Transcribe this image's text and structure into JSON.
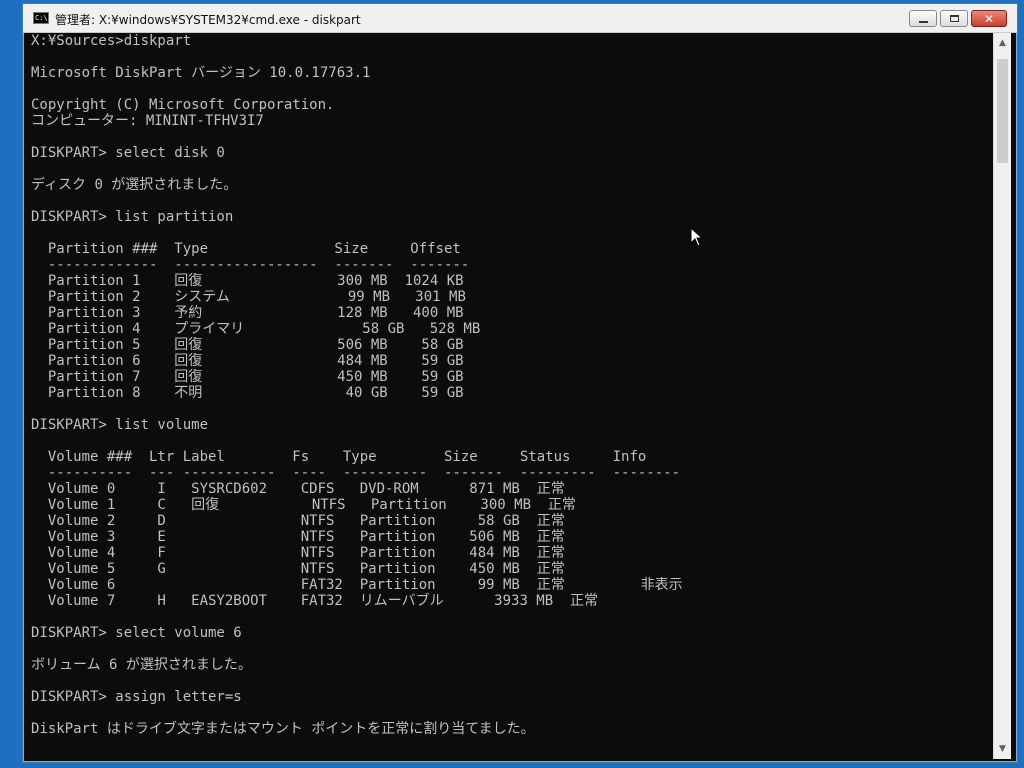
{
  "window": {
    "title": "管理者: X:¥windows¥SYSTEM32¥cmd.exe - diskpart",
    "icon_label": "C:\\."
  },
  "titlebar_buttons": {
    "close_glyph": "✕"
  },
  "console": {
    "lines": [
      "X:¥Sources>diskpart",
      "",
      "Microsoft DiskPart バージョン 10.0.17763.1",
      "",
      "Copyright (C) Microsoft Corporation.",
      "コンピューター: MININT-TFHV3I7",
      "",
      "DISKPART> select disk 0",
      "",
      "ディスク 0 が選択されました。",
      "",
      "DISKPART> list partition",
      "",
      "  Partition ###  Type               Size     Offset",
      "  -------------  -----------------  -------  -------",
      "  Partition 1    回復                300 MB  1024 KB",
      "  Partition 2    システム              99 MB   301 MB",
      "  Partition 3    予約                128 MB   400 MB",
      "  Partition 4    プライマリ              58 GB   528 MB",
      "  Partition 5    回復                506 MB    58 GB",
      "  Partition 6    回復                484 MB    59 GB",
      "  Partition 7    回復                450 MB    59 GB",
      "  Partition 8    不明                 40 GB    59 GB",
      "",
      "DISKPART> list volume",
      "",
      "  Volume ###  Ltr Label        Fs    Type        Size     Status     Info",
      "  ----------  --- -----------  ----  ----------  -------  ---------  --------",
      "  Volume 0     I   SYSRCD602    CDFS   DVD-ROM      871 MB  正常",
      "  Volume 1     C   回復           NTFS   Partition    300 MB  正常",
      "  Volume 2     D                NTFS   Partition     58 GB  正常",
      "  Volume 3     E                NTFS   Partition    506 MB  正常",
      "  Volume 4     F                NTFS   Partition    484 MB  正常",
      "  Volume 5     G                NTFS   Partition    450 MB  正常",
      "  Volume 6                      FAT32  Partition     99 MB  正常         非表示",
      "  Volume 7     H   EASY2BOOT    FAT32  リムーバブル      3933 MB  正常",
      "",
      "DISKPART> select volume 6",
      "",
      "ボリューム 6 が選択されました。",
      "",
      "DISKPART> assign letter=s",
      "",
      "DiskPart はドライブ文字またはマウント ポイントを正常に割り当てました。"
    ]
  },
  "scrollbar": {
    "up_glyph": "▲",
    "down_glyph": "▼"
  },
  "colors": {
    "console_bg": "#0c0c0c",
    "console_fg": "#c0c0c0",
    "desktop": "#1f6fc0",
    "close_button": "#c7402d"
  }
}
